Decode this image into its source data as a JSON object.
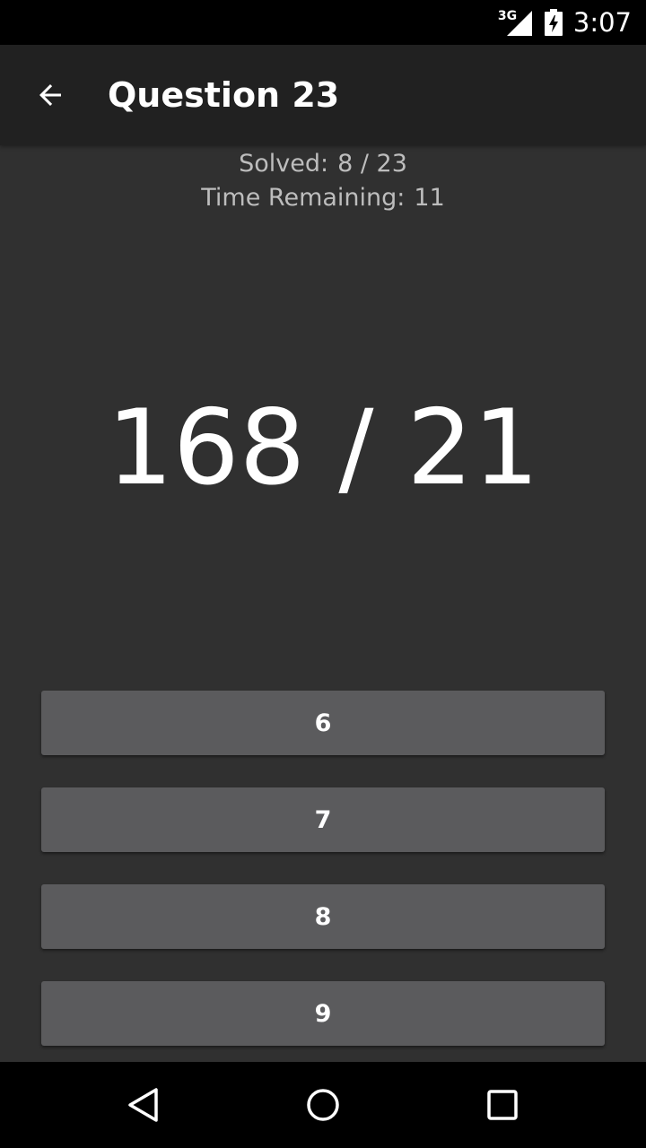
{
  "status_bar": {
    "network_type": "3G",
    "time": "3:07",
    "icons": [
      "signal-icon",
      "battery-charging-icon"
    ]
  },
  "app_bar": {
    "back_icon": "arrow-back-icon",
    "title": "Question 23"
  },
  "stats": {
    "solved_label": "Solved:",
    "solved_value": "8 / 23",
    "time_label": "Time Remaining:",
    "time_value": "11"
  },
  "problem": {
    "expression": "168 / 21"
  },
  "answers": [
    {
      "label": "6"
    },
    {
      "label": "7"
    },
    {
      "label": "8"
    },
    {
      "label": "9"
    }
  ],
  "nav_bar": {
    "icons": [
      "back-triangle-icon",
      "home-circle-icon",
      "recents-square-icon"
    ]
  },
  "colors": {
    "background": "#303030",
    "app_bar": "#212121",
    "button": "#5b5b5d",
    "text_primary": "#ffffff",
    "text_secondary": "#bdbdbd"
  }
}
